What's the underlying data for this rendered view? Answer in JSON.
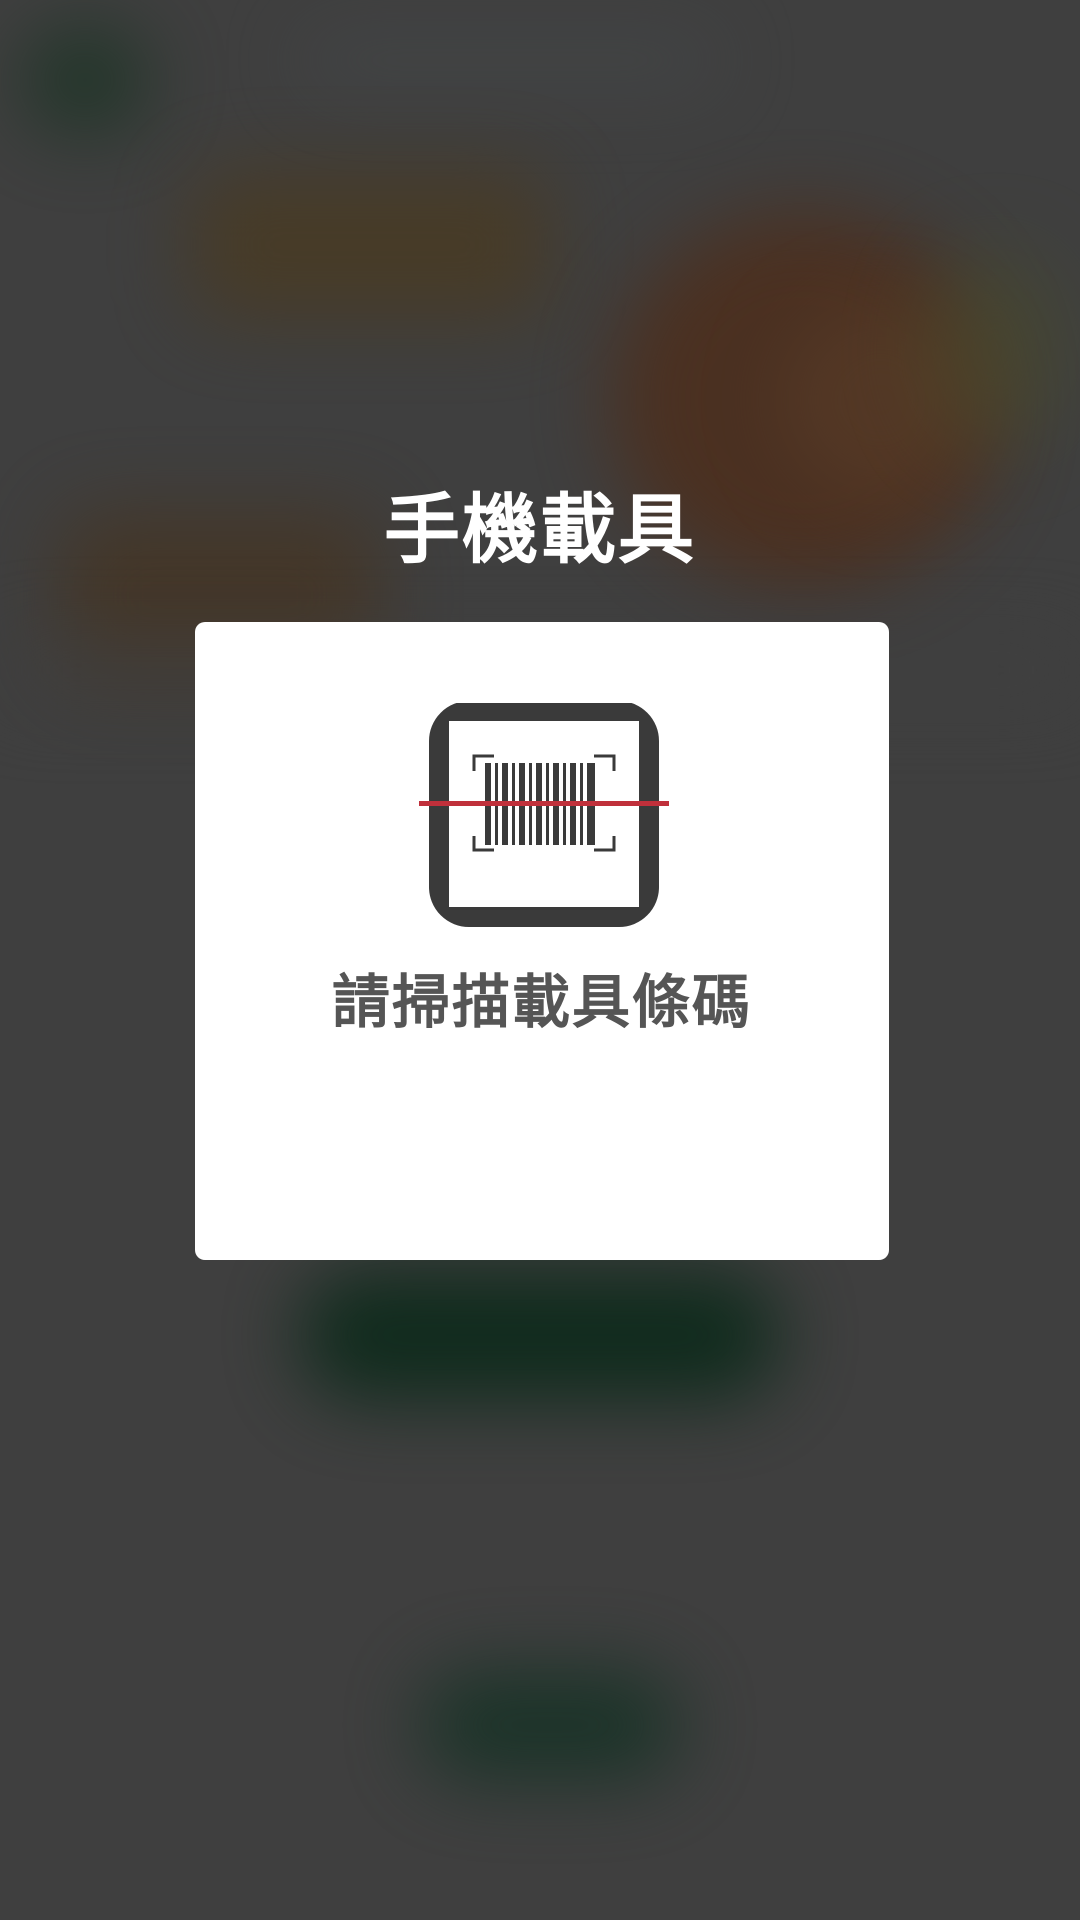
{
  "modal": {
    "title": "手機載具",
    "prompt": "請掃描載具條碼",
    "icon": "barcode-scan-icon"
  },
  "colors": {
    "overlay": "#3f3f3f",
    "dialog_bg": "#ffffff",
    "icon_frame": "#3a3a3a",
    "scan_line": "#c0303b",
    "prompt_text": "#555555"
  }
}
